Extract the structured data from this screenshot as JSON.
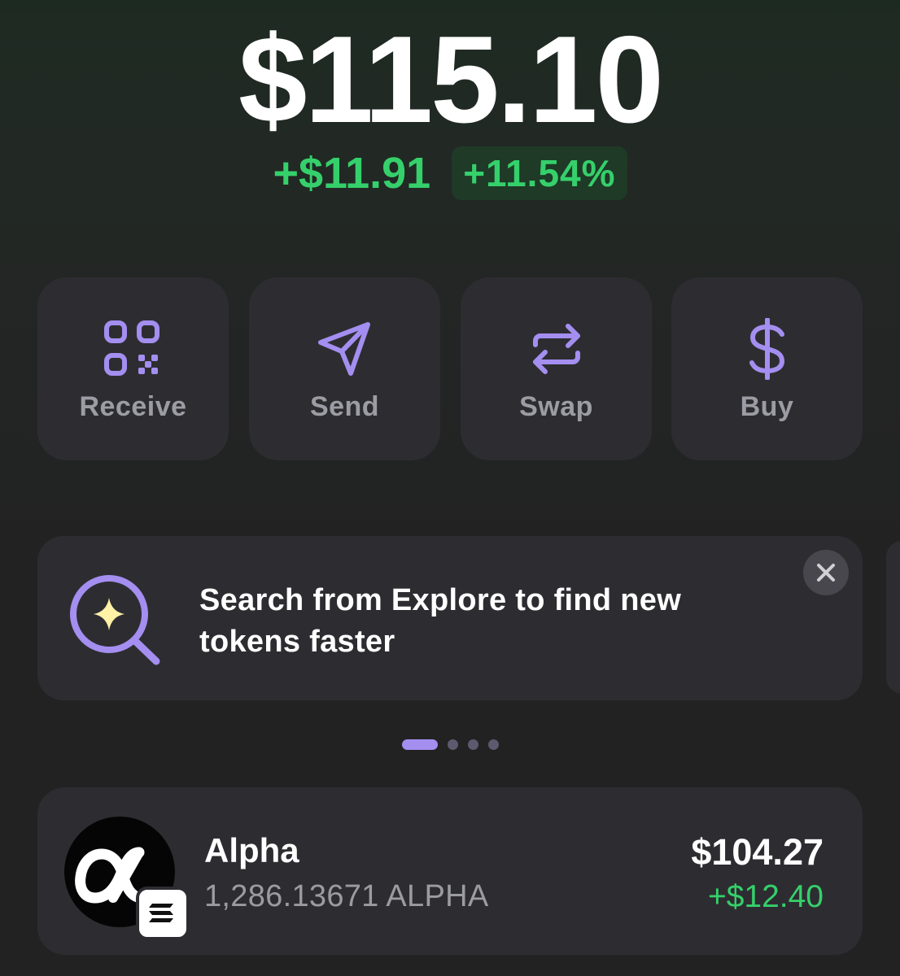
{
  "wallet": {
    "balance": "$115.10",
    "change_amount": "+$11.91",
    "change_percent": "+11.54%"
  },
  "actions": [
    {
      "label": "Receive",
      "icon": "qr-code-icon"
    },
    {
      "label": "Send",
      "icon": "send-icon"
    },
    {
      "label": "Swap",
      "icon": "swap-icon"
    },
    {
      "label": "Buy",
      "icon": "dollar-icon"
    }
  ],
  "banner": {
    "text": "Search from Explore to find new tokens faster",
    "icon": "search-sparkle-icon",
    "close_icon": "close-icon"
  },
  "pager": {
    "pages": 4,
    "active_index": 0
  },
  "tokens": [
    {
      "name": "Alpha",
      "amount": "1,286.13671 ALPHA",
      "value": "$104.27",
      "change": "+$12.40",
      "icon": "alpha-token-icon",
      "chain_icon": "solana-badge-icon"
    }
  ],
  "colors": {
    "accent": "#a48ef0",
    "positive": "#35d06b",
    "card": "#2d2d31",
    "muted_text": "#9c9ca4"
  }
}
